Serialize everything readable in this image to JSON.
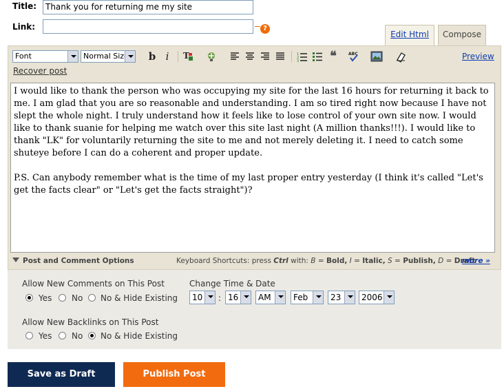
{
  "post": {
    "title_label": "Title:",
    "title_value": "Thank you for returning me my site",
    "link_label": "Link:",
    "link_value": "",
    "help_glyph": "?"
  },
  "tabs": {
    "edit_html": "Edit Html",
    "compose": "Compose"
  },
  "toolbar": {
    "font_value": "Font",
    "size_value": "Normal Size",
    "bold": "b",
    "italic": "i",
    "preview": "Preview",
    "recover": "Recover post",
    "icons": [
      "text-color-icon",
      "link-icon",
      "align-left-icon",
      "align-center-icon",
      "align-right-icon",
      "align-justify-icon",
      "numbered-list-icon",
      "bullet-list-icon",
      "blockquote-icon",
      "spellcheck-icon",
      "image-icon",
      "remove-formatting-icon"
    ]
  },
  "body": {
    "paragraph1": "I would like to thank the person who was occupying my site for the last 16 hours for returning it back to me. I am glad that you are so reasonable and understanding. I am so tired right now because I have not slept the whole night. I truly understand how it feels like to lose control of your own site now. I would like to thank suanie for helping me watch over this site last night (A million thanks!!!). I would like to thank \"LK\" for voluntarily returning the site to me and not merely deleting it. I need to catch some shuteye before I can do a coherent and proper update.",
    "paragraph2": "P.S. Can anybody remember what is the time of my last proper entry yesterday (I think it's called \"Let's get the facts clear\" or \"Let's get the facts straight\")?"
  },
  "options": {
    "toggle_label": "Post and Comment Options",
    "shortcuts_prefix": "Keyboard Shortcuts: press",
    "shortcuts_key": "Ctrl",
    "shortcuts_with": "with:",
    "shortcut_b": "B",
    "shortcut_b_label": "Bold,",
    "shortcut_i": "I",
    "shortcut_i_label": "Italic,",
    "shortcut_s": "S",
    "shortcut_s_label": "Publish,",
    "shortcut_d": "D",
    "shortcut_d_label": "Draft",
    "more": "more »",
    "comments_label": "Allow New Comments on This Post",
    "comments_choices": [
      "Yes",
      "No",
      "No & Hide Existing"
    ],
    "comments_selected": "Yes",
    "backlinks_label": "Allow New Backlinks on This Post",
    "backlinks_choices": [
      "Yes",
      "No",
      "No & Hide Existing"
    ],
    "backlinks_selected": "No & Hide Existing",
    "datetime_label": "Change Time & Date",
    "hour": "10",
    "minute": "16",
    "ampm": "AM",
    "month": "Feb",
    "day": "23",
    "year": "2006",
    "time_separator": ":"
  },
  "actions": {
    "save_draft": "Save as Draft",
    "publish": "Publish Post"
  },
  "colors": {
    "draft_button": "#0f2a52",
    "publish_button": "#f26b0f",
    "panel": "#e8e3d4",
    "link": "#103cb0"
  }
}
